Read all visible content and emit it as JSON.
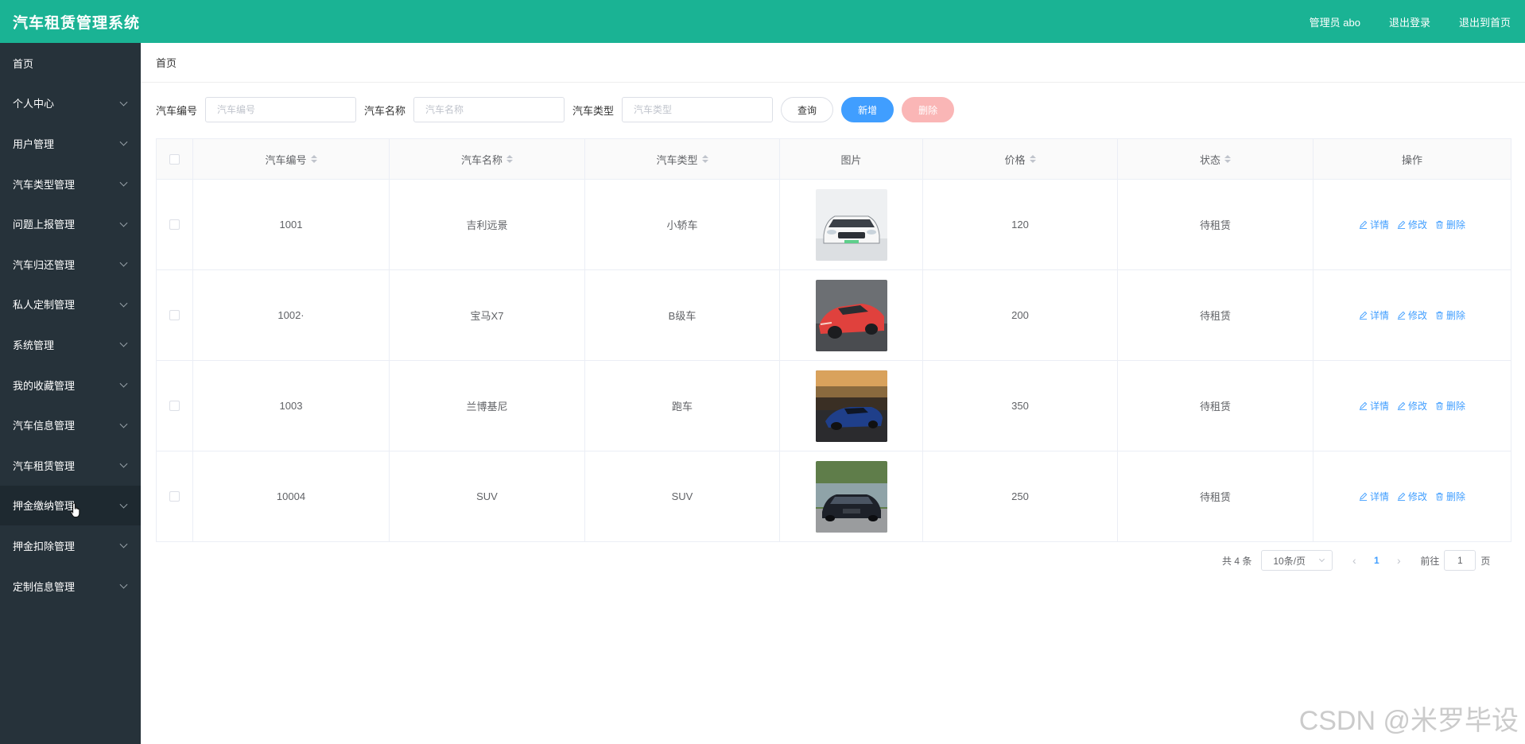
{
  "header": {
    "title": "汽车租赁管理系统",
    "admin_label": "管理员 abo",
    "logout_label": "退出登录",
    "home_label": "退出到首页"
  },
  "sidebar": {
    "items": [
      {
        "label": "首页"
      },
      {
        "label": "个人中心"
      },
      {
        "label": "用户管理"
      },
      {
        "label": "汽车类型管理"
      },
      {
        "label": "问题上报管理"
      },
      {
        "label": "汽车归还管理"
      },
      {
        "label": "私人定制管理"
      },
      {
        "label": "系统管理"
      },
      {
        "label": "我的收藏管理"
      },
      {
        "label": "汽车信息管理"
      },
      {
        "label": "汽车租赁管理"
      },
      {
        "label": "押金缴纳管理"
      },
      {
        "label": "押金扣除管理"
      },
      {
        "label": "定制信息管理"
      }
    ]
  },
  "breadcrumb": "首页",
  "filters": {
    "code_label": "汽车编号",
    "code_placeholder": "汽车编号",
    "name_label": "汽车名称",
    "name_placeholder": "汽车名称",
    "type_label": "汽车类型",
    "type_placeholder": "汽车类型",
    "query_label": "查询",
    "add_label": "新增",
    "delete_label": "删除"
  },
  "table": {
    "headers": {
      "code": "汽车编号",
      "name": "汽车名称",
      "type": "汽车类型",
      "image": "图片",
      "price": "价格",
      "status": "状态",
      "ops": "操作"
    },
    "op_labels": {
      "detail": "详情",
      "edit": "修改",
      "delete": "删除"
    },
    "rows": [
      {
        "code": "1001",
        "name": "吉利远景",
        "type": "小轿车",
        "price": "120",
        "status": "待租赁"
      },
      {
        "code": "1002·",
        "name": "宝马X7",
        "type": "B级车",
        "price": "200",
        "status": "待租赁"
      },
      {
        "code": "1003",
        "name": "兰博基尼",
        "type": "跑车",
        "price": "350",
        "status": "待租赁"
      },
      {
        "code": "10004",
        "name": "SUV",
        "type": "SUV",
        "price": "250",
        "status": "待租赁"
      }
    ]
  },
  "pagination": {
    "total": "共 4 条",
    "page_size": "10条/页",
    "current_page": "1",
    "goto_label": "前往",
    "goto_value": "1",
    "page_suffix": "页"
  },
  "watermark": "CSDN @米罗毕设"
}
